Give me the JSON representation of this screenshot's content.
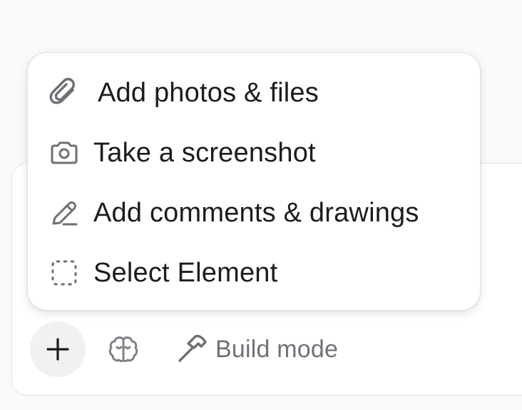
{
  "menu": {
    "items": [
      {
        "label": "Add photos & files",
        "icon": "paperclip-icon"
      },
      {
        "label": "Take a screenshot",
        "icon": "camera-icon"
      },
      {
        "label": "Add comments & drawings",
        "icon": "pencil-icon"
      },
      {
        "label": "Select Element",
        "icon": "dashed-square-icon"
      }
    ]
  },
  "toolbar": {
    "plus_icon": "plus-icon",
    "brain_icon": "brain-icon",
    "build_mode_label": "Build mode",
    "build_mode_icon": "hammer-icon"
  },
  "colors": {
    "icon_gray": "#6f6f76",
    "text_dark": "#1c1c1e",
    "muted_text": "#707078",
    "plus_bg": "#f1f1f2"
  }
}
